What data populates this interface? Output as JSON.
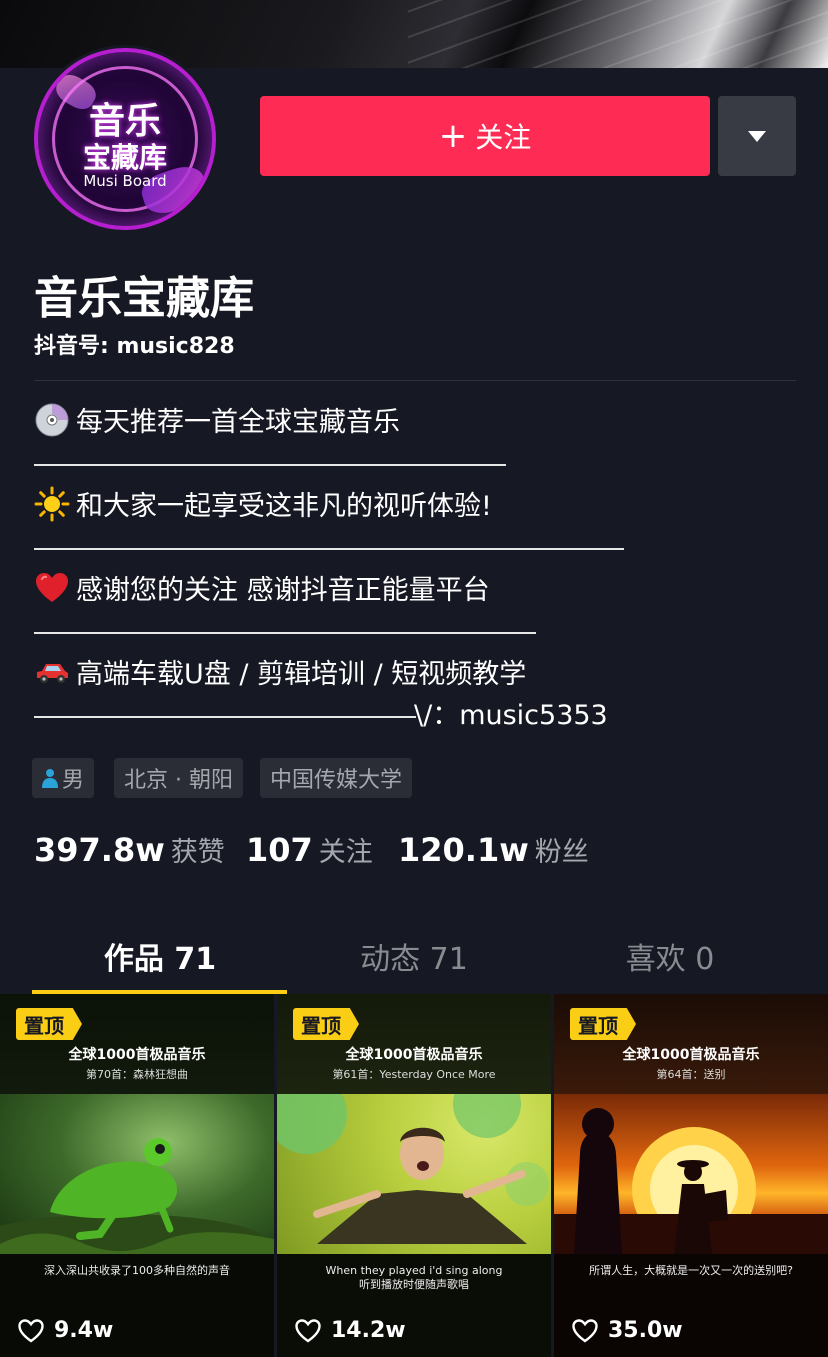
{
  "profile": {
    "avatar_text_line1": "音乐",
    "avatar_text_line2": "宝藏库",
    "avatar_text_line3": "Musi Board",
    "name": "音乐宝藏库",
    "douyin_id_label": "抖音号: music828"
  },
  "actions": {
    "follow_label": "关注",
    "follow_icon": "plus-icon",
    "more_icon": "caret-down-icon"
  },
  "bio": {
    "line1": "每天推荐一首全球宝藏音乐",
    "line2": "和大家一起享受这非凡的视听体验!",
    "line3": "感谢您的关注 感谢抖音正能量平台",
    "line4": "高端车载U盘 / 剪辑培训 / 短视频教学",
    "line5": "\\/：music5353"
  },
  "tags": {
    "gender": "男",
    "location": "北京 · 朝阳",
    "school": "中国传媒大学"
  },
  "stats": {
    "likes_num": "397.8w",
    "likes_label": "获赞",
    "following_num": "107",
    "following_label": "关注",
    "followers_num": "120.1w",
    "followers_label": "粉丝"
  },
  "tabs": [
    {
      "label": "作品 71",
      "active": true
    },
    {
      "label": "动态 71",
      "active": false
    },
    {
      "label": "喜欢 0",
      "active": false
    }
  ],
  "videos": [
    {
      "pinned": "置顶",
      "title": "全球1000首极品音乐",
      "subtitle": "第70首：森林狂想曲",
      "caption": "深入深山共收录了100多种自然的声音",
      "likes": "9.4w"
    },
    {
      "pinned": "置顶",
      "title": "全球1000首极品音乐",
      "subtitle": "第61首：Yesterday Once More",
      "caption": "When they played i'd sing along",
      "caption2": "听到播放时便随声歌唱",
      "likes": "14.2w"
    },
    {
      "pinned": "置顶",
      "title": "全球1000首极品音乐",
      "subtitle": "第64首：送别",
      "caption": "所谓人生，大概就是一次又一次的送别吧?",
      "likes": "35.0w"
    }
  ],
  "colors": {
    "background": "#161823",
    "follow_button": "#fe2c55",
    "tab_underline": "#face15",
    "secondary_text": "#a5a7ae"
  }
}
